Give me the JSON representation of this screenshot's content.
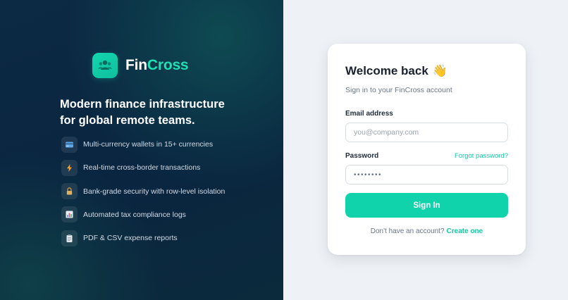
{
  "brand": {
    "name_part1": "Fin",
    "name_part2": "Cross",
    "logo_icon": "people-icon",
    "accent_color": "#10d3ac"
  },
  "hero": {
    "tagline": "Modern finance infrastructure for global remote teams."
  },
  "features": [
    {
      "icon": "credit-card-icon",
      "label": "Multi-currency wallets in 15+ currencies"
    },
    {
      "icon": "lightning-icon",
      "label": "Real-time cross-border transactions"
    },
    {
      "icon": "lock-icon",
      "label": "Bank-grade security with row-level isolation"
    },
    {
      "icon": "bar-chart-icon",
      "label": "Automated tax compliance logs"
    },
    {
      "icon": "clipboard-icon",
      "label": "PDF & CSV expense reports"
    }
  ],
  "login": {
    "title": "Welcome back",
    "wave_emoji": "👋",
    "subtitle": "Sign in to your FinCross account",
    "email_label": "Email address",
    "email_placeholder": "you@company.com",
    "password_label": "Password",
    "password_value": "••••••••",
    "forgot_link": "Forgot password?",
    "submit_label": "Sign In",
    "signup_prompt": "Don't have an account?",
    "signup_link": "Create one"
  }
}
